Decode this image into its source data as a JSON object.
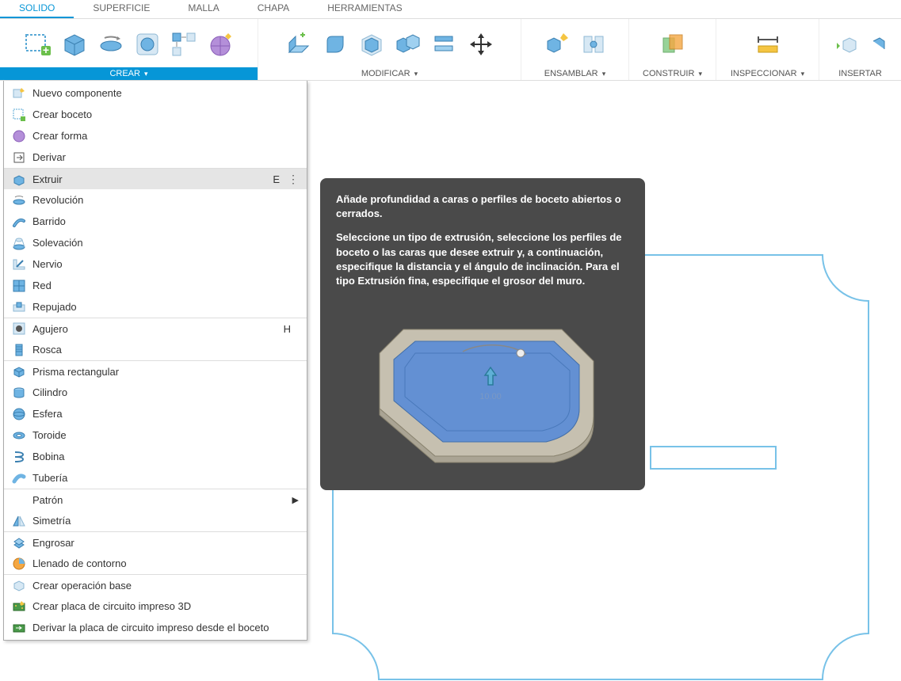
{
  "tabs": {
    "solido": "SOLIDO",
    "superficie": "SUPERFICIE",
    "malla": "MALLA",
    "chapa": "CHAPA",
    "herramientas": "HERRAMIENTAS"
  },
  "ribbon": {
    "crear": "CREAR",
    "modificar": "MODIFICAR",
    "ensamblar": "ENSAMBLAR",
    "construir": "CONSTRUIR",
    "inspeccionar": "INSPECCIONAR",
    "insertar": "INSERTAR"
  },
  "menu": {
    "nuevo_componente": "Nuevo componente",
    "crear_boceto": "Crear boceto",
    "crear_forma": "Crear forma",
    "derivar": "Derivar",
    "extruir": "Extruir",
    "extruir_key": "E",
    "revolucion": "Revolución",
    "barrido": "Barrido",
    "solevacion": "Solevación",
    "nervio": "Nervio",
    "red": "Red",
    "repujado": "Repujado",
    "agujero": "Agujero",
    "agujero_key": "H",
    "rosca": "Rosca",
    "prisma": "Prisma rectangular",
    "cilindro": "Cilindro",
    "esfera": "Esfera",
    "toroide": "Toroide",
    "bobina": "Bobina",
    "tuberia": "Tubería",
    "patron": "Patrón",
    "simetria": "Simetría",
    "engrosar": "Engrosar",
    "llenado": "Llenado de contorno",
    "crear_op_base": "Crear operación base",
    "crear_placa": "Crear placa de circuito impreso 3D",
    "derivar_placa": "Derivar la placa de circuito impreso desde el boceto"
  },
  "tooltip": {
    "p1": "Añade profundidad a caras o perfiles de boceto abiertos o cerrados.",
    "p2": "Seleccione un tipo de extrusión, seleccione los perfiles de boceto o las caras que desee extruir y, a continuación, especifique la distancia y el ángulo de inclinación. Para el tipo Extrusión fina, especifique el grosor del muro.",
    "dim": "10.00"
  }
}
